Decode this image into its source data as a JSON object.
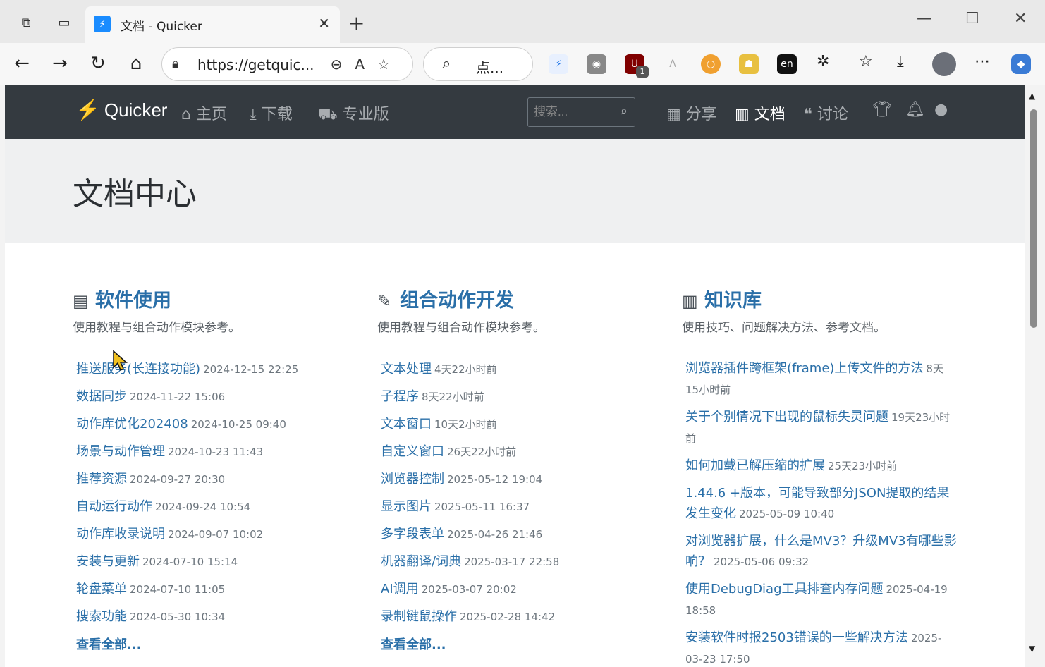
{
  "browser": {
    "tab_title": "文档 - Quicker",
    "url": "https://getquic...",
    "search_text": "点...",
    "ext_badge": "1"
  },
  "site": {
    "brand": "Quicker",
    "nav": [
      "主页",
      "下载",
      "专业版"
    ],
    "search_placeholder": "搜索...",
    "nav_right": [
      "分享",
      "文档",
      "讨论"
    ]
  },
  "page_title": "文档中心",
  "columns": [
    {
      "title": "软件使用",
      "desc": "使用教程与组合动作模块参考。",
      "items": [
        {
          "label": "推送服务(长连接功能)",
          "meta": "2024-12-15 22:25"
        },
        {
          "label": "数据同步",
          "meta": "2024-11-22 15:06"
        },
        {
          "label": "动作库优化202408",
          "meta": "2024-10-25 09:40"
        },
        {
          "label": "场景与动作管理",
          "meta": "2024-10-23 11:43"
        },
        {
          "label": "推荐资源",
          "meta": "2024-09-27 20:30"
        },
        {
          "label": "自动运行动作",
          "meta": "2024-09-24 10:54"
        },
        {
          "label": "动作库收录说明",
          "meta": "2024-09-07 10:02"
        },
        {
          "label": "安装与更新",
          "meta": "2024-07-10 15:14"
        },
        {
          "label": "轮盘菜单",
          "meta": "2024-07-10 11:05"
        },
        {
          "label": "搜索功能",
          "meta": "2024-05-30 10:34"
        }
      ],
      "more": "查看全部..."
    },
    {
      "title": "组合动作开发",
      "desc": "使用教程与组合动作模块参考。",
      "items": [
        {
          "label": "文本处理",
          "meta": "4天22小时前"
        },
        {
          "label": "子程序",
          "meta": "8天22小时前"
        },
        {
          "label": "文本窗口",
          "meta": "10天2小时前"
        },
        {
          "label": "自定义窗口",
          "meta": "26天22小时前"
        },
        {
          "label": "浏览器控制",
          "meta": "2025-05-12 19:04"
        },
        {
          "label": "显示图片",
          "meta": "2025-05-11 16:37"
        },
        {
          "label": "多字段表单",
          "meta": "2025-04-26 21:46"
        },
        {
          "label": "机器翻译/词典",
          "meta": "2025-03-17 22:58"
        },
        {
          "label": "AI调用",
          "meta": "2025-03-07 20:02"
        },
        {
          "label": "录制键鼠操作",
          "meta": "2025-02-28 14:42"
        }
      ],
      "more": "查看全部..."
    },
    {
      "title": "知识库",
      "desc": "使用技巧、问题解决方法、参考文档。",
      "items": [
        {
          "label": "浏览器插件跨框架(frame)上传文件的方法",
          "meta": "8天15小时前"
        },
        {
          "label": "关于个别情况下出现的鼠标失灵问题",
          "meta": "19天23小时前"
        },
        {
          "label": "如何加载已解压缩的扩展",
          "meta": "25天23小时前"
        },
        {
          "label": "1.44.6 +版本，可能导致部分JSON提取的结果发生变化",
          "meta": "2025-05-09 10:40"
        },
        {
          "label": "对浏览器扩展，什么是MV3？升级MV3有哪些影响？",
          "meta": "2025-05-06 09:32"
        },
        {
          "label": "使用DebugDiag工具排查内存问题",
          "meta": "2025-04-19 18:58"
        },
        {
          "label": "安装软件时报2503错误的一些解决方法",
          "meta": "2025-03-23 17:50"
        }
      ]
    }
  ]
}
